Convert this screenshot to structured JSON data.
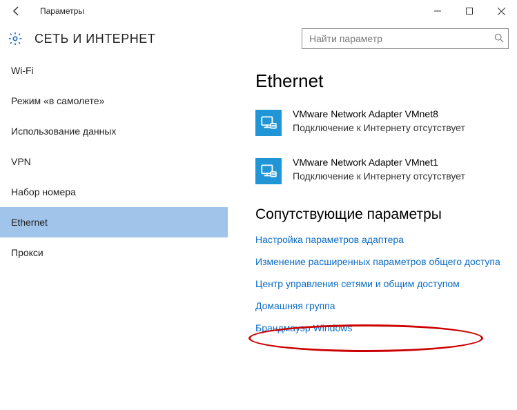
{
  "window": {
    "title": "Параметры"
  },
  "header": {
    "heading": "СЕТЬ И ИНТЕРНЕТ",
    "search_placeholder": "Найти параметр"
  },
  "sidebar": {
    "items": [
      {
        "label": "Wi-Fi"
      },
      {
        "label": "Режим «в самолете»"
      },
      {
        "label": "Использование данных"
      },
      {
        "label": "VPN"
      },
      {
        "label": "Набор номера"
      },
      {
        "label": "Ethernet"
      },
      {
        "label": "Прокси"
      }
    ],
    "selected_index": 5
  },
  "main": {
    "title": "Ethernet",
    "adapters": [
      {
        "name": "VMware Network Adapter VMnet8",
        "status": "Подключение к Интернету отсутствует"
      },
      {
        "name": "VMware Network Adapter VMnet1",
        "status": "Подключение к Интернету отсутствует"
      }
    ],
    "related_heading": "Сопутствующие параметры",
    "links": [
      "Настройка параметров адаптера",
      "Изменение расширенных параметров общего доступа",
      "Центр управления сетями и общим доступом",
      "Домашняя группа",
      "Брандмауэр Windows"
    ]
  }
}
